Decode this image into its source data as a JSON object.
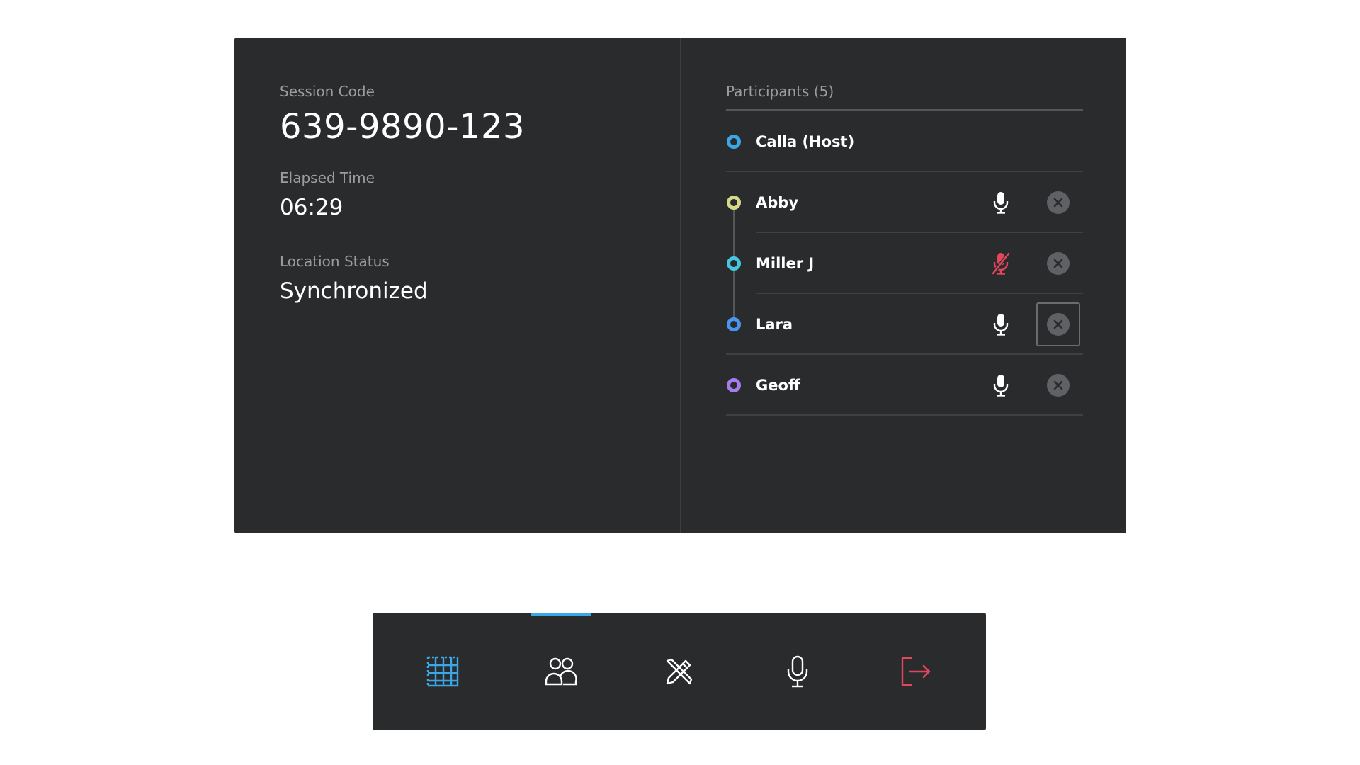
{
  "session": {
    "code_label": "Session Code",
    "code": "639-9890-123",
    "elapsed_label": "Elapsed Time",
    "elapsed": "06:29",
    "location_label": "Location Status",
    "location": "Synchronized"
  },
  "participants": {
    "header": "Participants (5)",
    "items": [
      {
        "name": "Calla (Host)",
        "color": "#3aa7e8",
        "host": true
      },
      {
        "name": "Abby",
        "color": "#d7d88a",
        "mic": "on"
      },
      {
        "name": "Miller J",
        "color": "#45c7e0",
        "mic": "muted",
        "muted_color": "#e2465a"
      },
      {
        "name": "Lara",
        "color": "#4a95f0",
        "mic": "on",
        "remove_focused": true
      },
      {
        "name": "Geoff",
        "color": "#a67cf0",
        "mic": "on"
      }
    ]
  },
  "toolbar": {
    "items": [
      {
        "icon": "grid-icon",
        "active": true,
        "color": "#3aa7e8"
      },
      {
        "icon": "participants-icon",
        "color": "#ffffff"
      },
      {
        "icon": "tools-icon",
        "color": "#ffffff"
      },
      {
        "icon": "microphone-icon",
        "color": "#ffffff"
      },
      {
        "icon": "exit-icon",
        "color": "#e2465a"
      }
    ]
  }
}
